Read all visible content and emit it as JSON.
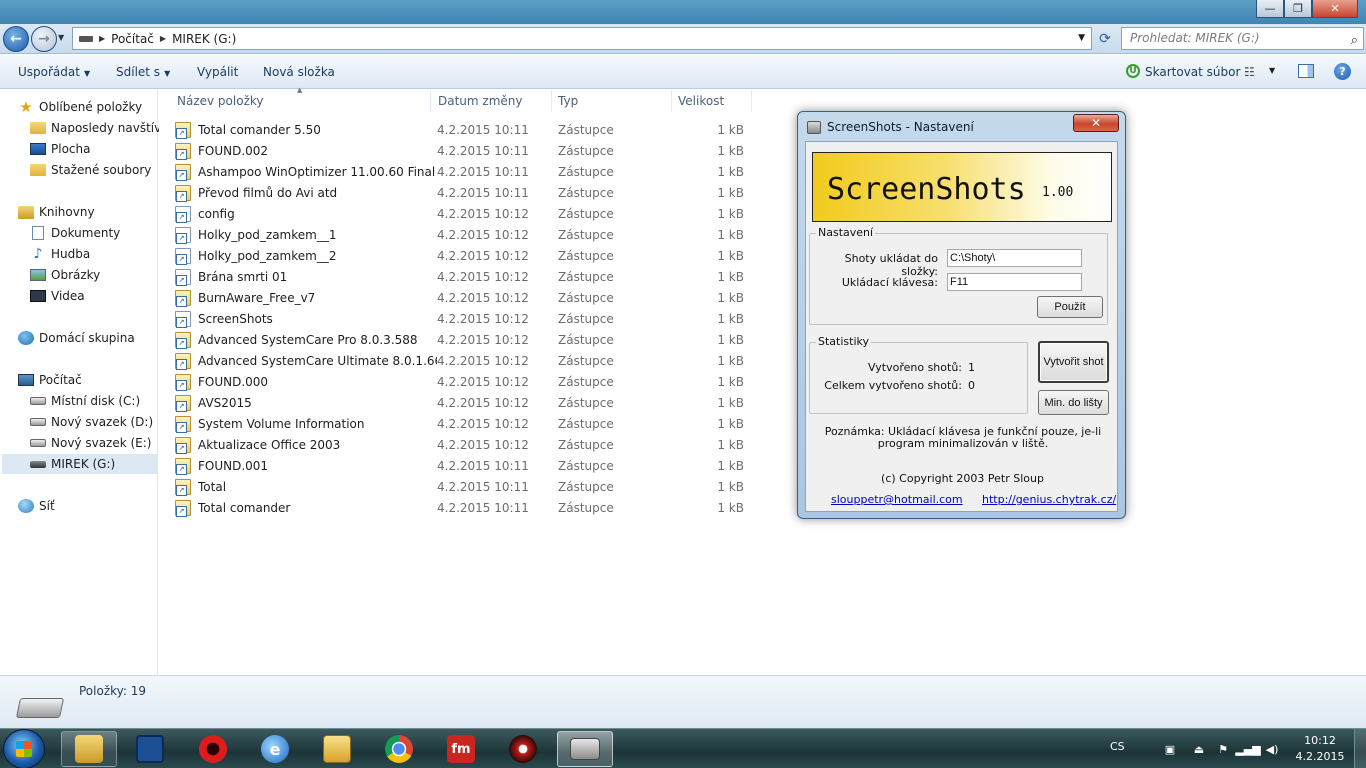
{
  "window": {
    "minimize": "—",
    "maximize": "❐",
    "close": "✕"
  },
  "address": {
    "crumbs": [
      "Počítač",
      "MIREK (G:)"
    ],
    "search_placeholder": "Prohledat: MIREK (G:)"
  },
  "toolbar": {
    "organize": "Uspořádat",
    "share": "Sdílet s",
    "burn": "Vypálit",
    "new_folder": "Nová složka",
    "scan": "Skartovat súbor"
  },
  "nav": {
    "favorites": "Oblíbené položky",
    "recent": "Naposledy navštívené",
    "desktop": "Plocha",
    "downloads": "Stažené soubory",
    "libraries": "Knihovny",
    "documents": "Dokumenty",
    "music": "Hudba",
    "pictures": "Obrázky",
    "videos": "Videa",
    "homegroup": "Domácí skupina",
    "computer": "Počítač",
    "drive_c": "Místní disk (C:)",
    "drive_d": "Nový svazek (D:)",
    "drive_e": "Nový svazek (E:)",
    "drive_g": "MIREK (G:)",
    "network": "Síť"
  },
  "columns": {
    "name": "Název položky",
    "date": "Datum změny",
    "type": "Typ",
    "size": "Velikost"
  },
  "files": [
    {
      "name": "Total comander 5.50",
      "date": "4.2.2015 10:11",
      "type": "Zástupce",
      "size": "1 kB"
    },
    {
      "name": "FOUND.002",
      "date": "4.2.2015 10:11",
      "type": "Zástupce",
      "size": "1 kB"
    },
    {
      "name": "Ashampoo WinOptimizer 11.00.60 Final ...",
      "date": "4.2.2015 10:11",
      "type": "Zástupce",
      "size": "1 kB"
    },
    {
      "name": "Převod filmů do Avi atd",
      "date": "4.2.2015 10:11",
      "type": "Zástupce",
      "size": "1 kB"
    },
    {
      "name": "config",
      "date": "4.2.2015 10:12",
      "type": "Zástupce",
      "size": "1 kB"
    },
    {
      "name": "Holky_pod_zamkem__1",
      "date": "4.2.2015 10:12",
      "type": "Zástupce",
      "size": "1 kB"
    },
    {
      "name": "Holky_pod_zamkem__2",
      "date": "4.2.2015 10:12",
      "type": "Zástupce",
      "size": "1 kB"
    },
    {
      "name": "Brána smrti 01",
      "date": "4.2.2015 10:12",
      "type": "Zástupce",
      "size": "1 kB"
    },
    {
      "name": "BurnAware_Free_v7",
      "date": "4.2.2015 10:12",
      "type": "Zástupce",
      "size": "1 kB"
    },
    {
      "name": "ScreenShots",
      "date": "4.2.2015 10:12",
      "type": "Zástupce",
      "size": "1 kB"
    },
    {
      "name": "Advanced SystemCare Pro 8.0.3.588",
      "date": "4.2.2015 10:12",
      "type": "Zástupce",
      "size": "1 kB"
    },
    {
      "name": "Advanced SystemCare Ultimate 8.0.1.660 ...",
      "date": "4.2.2015 10:12",
      "type": "Zástupce",
      "size": "1 kB"
    },
    {
      "name": "FOUND.000",
      "date": "4.2.2015 10:12",
      "type": "Zástupce",
      "size": "1 kB"
    },
    {
      "name": "AVS2015",
      "date": "4.2.2015 10:12",
      "type": "Zástupce",
      "size": "1 kB"
    },
    {
      "name": "System Volume Information",
      "date": "4.2.2015 10:12",
      "type": "Zástupce",
      "size": "1 kB"
    },
    {
      "name": "Aktualizace Office 2003",
      "date": "4.2.2015 10:12",
      "type": "Zástupce",
      "size": "1 kB"
    },
    {
      "name": "FOUND.001",
      "date": "4.2.2015 10:11",
      "type": "Zástupce",
      "size": "1 kB"
    },
    {
      "name": "Total",
      "date": "4.2.2015 10:11",
      "type": "Zástupce",
      "size": "1 kB"
    },
    {
      "name": "Total comander",
      "date": "4.2.2015 10:11",
      "type": "Zástupce",
      "size": "1 kB"
    }
  ],
  "status": {
    "count": "Položky: 19"
  },
  "dialog": {
    "title": "ScreenShots - Nastavení",
    "banner_title": "ScreenShots",
    "banner_version": "1.00",
    "settings_group": "Nastavení",
    "folder_label": "Shoty ukládat do složky:",
    "folder_value": "C:\\Shoty\\",
    "key_label": "Ukládací klávesa:",
    "key_value": "F11",
    "apply_button": "Použít",
    "stats_group": "Statistiky",
    "created_label": "Vytvořeno shotů:",
    "created_value": "1",
    "total_label": "Celkem vytvořeno shotů:",
    "total_value": "0",
    "shot_button": "Vytvořit shot",
    "minimize_button": "Min. do lišty",
    "note": "Poznámka: Ukládací klávesa je funkční pouze, je-li program minimalizován v liště.",
    "copyright": "(c) Copyright 2003 Petr Sloup",
    "email": "slouppetr@hotmail.com",
    "url": "http://genius.chytrak.cz/"
  },
  "taskbar": {
    "lang": "CS",
    "time": "10:12",
    "date": "4.2.2015",
    "app_fm": "fm"
  },
  "colors": {
    "accent": "#3f84b4",
    "banner_yellow": "#f2cb1c",
    "close_red": "#c8452d"
  }
}
